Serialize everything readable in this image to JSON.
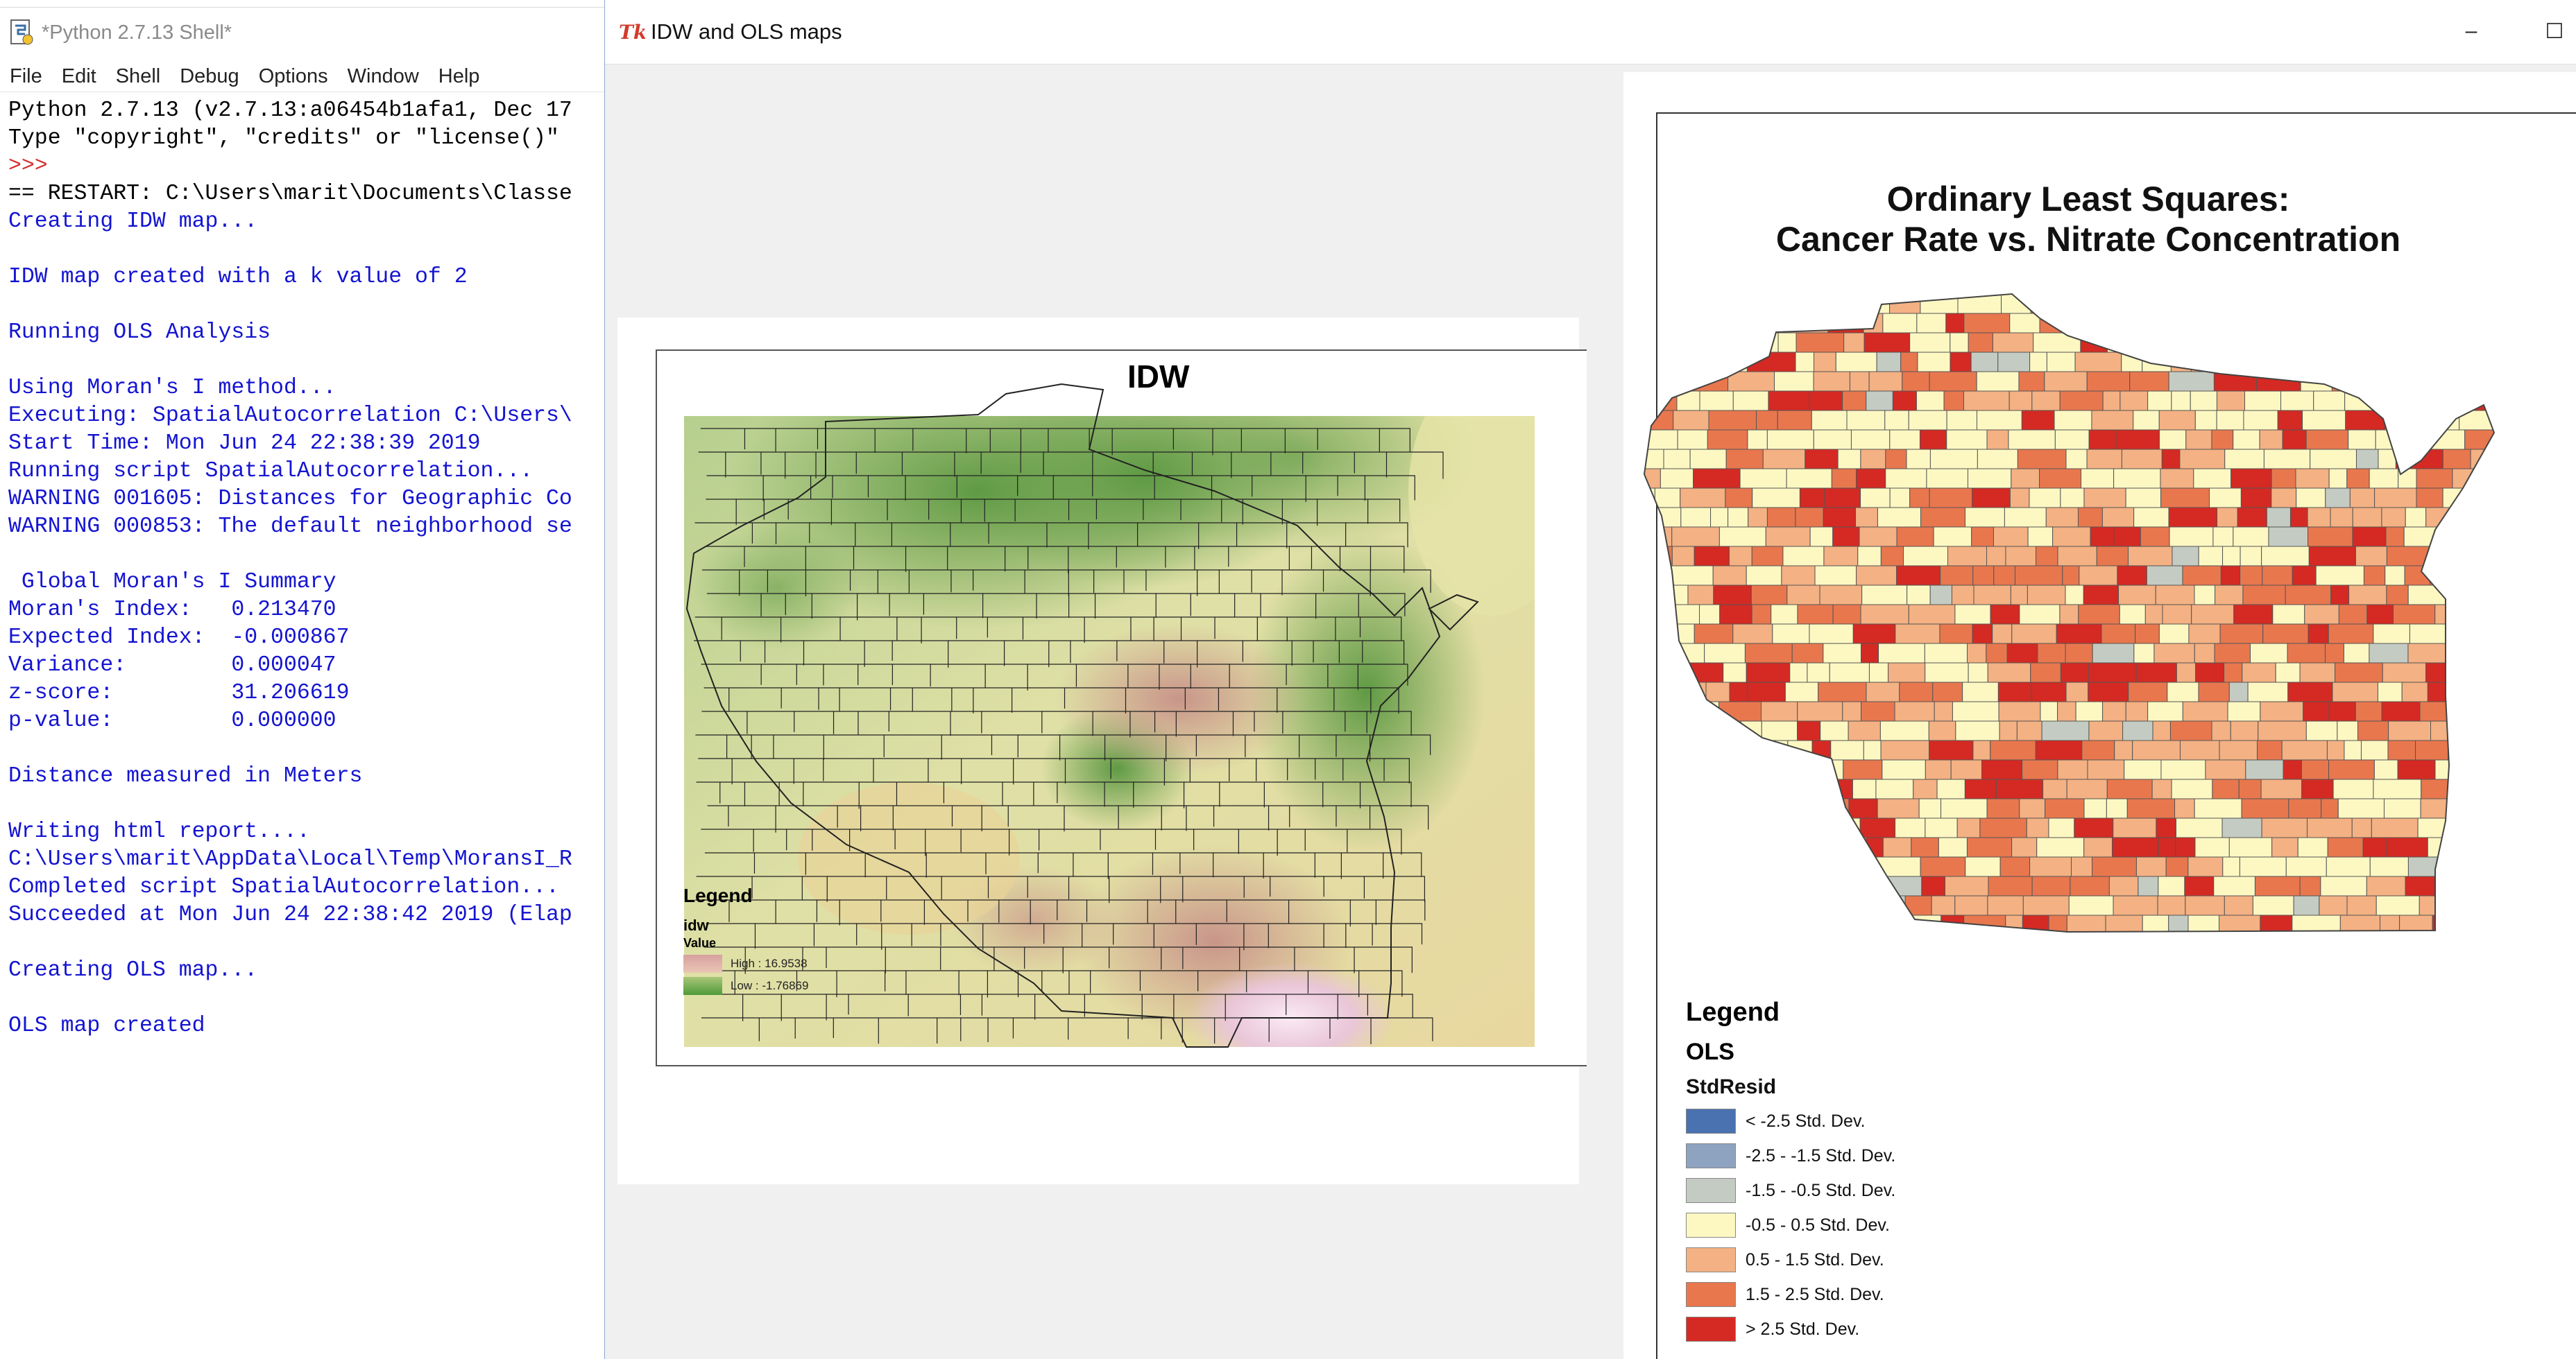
{
  "shell": {
    "title": "*Python 2.7.13 Shell*",
    "menu": [
      "File",
      "Edit",
      "Shell",
      "Debug",
      "Options",
      "Window",
      "Help"
    ],
    "lines": [
      {
        "t": "Python 2.7.13 (v2.7.13:a06454b1afa1, Dec 17",
        "c": "k"
      },
      {
        "t": "Type \"copyright\", \"credits\" or \"license()\"",
        "c": "k"
      },
      {
        "t": ">>>",
        "c": "r"
      },
      {
        "t": "== RESTART: C:\\Users\\marit\\Documents\\Classe",
        "c": "k"
      },
      {
        "t": "Creating IDW map...",
        "c": "b"
      },
      {
        "t": "",
        "c": "b"
      },
      {
        "t": "IDW map created with a k value of 2",
        "c": "b"
      },
      {
        "t": "",
        "c": "b"
      },
      {
        "t": "Running OLS Analysis",
        "c": "b"
      },
      {
        "t": "",
        "c": "b"
      },
      {
        "t": "Using Moran's I method...",
        "c": "b"
      },
      {
        "t": "Executing: SpatialAutocorrelation C:\\Users\\",
        "c": "b"
      },
      {
        "t": "Start Time: Mon Jun 24 22:38:39 2019",
        "c": "b"
      },
      {
        "t": "Running script SpatialAutocorrelation...",
        "c": "b"
      },
      {
        "t": "WARNING 001605: Distances for Geographic Co",
        "c": "b"
      },
      {
        "t": "WARNING 000853: The default neighborhood se",
        "c": "b"
      },
      {
        "t": "",
        "c": "b"
      },
      {
        "t": " Global Moran's I Summary",
        "c": "b"
      },
      {
        "t": "Moran's Index:   0.213470",
        "c": "b"
      },
      {
        "t": "Expected Index:  -0.000867",
        "c": "b"
      },
      {
        "t": "Variance:        0.000047",
        "c": "b"
      },
      {
        "t": "z-score:         31.206619",
        "c": "b"
      },
      {
        "t": "p-value:         0.000000",
        "c": "b"
      },
      {
        "t": "",
        "c": "b"
      },
      {
        "t": "Distance measured in Meters",
        "c": "b"
      },
      {
        "t": "",
        "c": "b"
      },
      {
        "t": "Writing html report....",
        "c": "b"
      },
      {
        "t": "C:\\Users\\marit\\AppData\\Local\\Temp\\MoransI_R",
        "c": "b"
      },
      {
        "t": "Completed script SpatialAutocorrelation...",
        "c": "b"
      },
      {
        "t": "Succeeded at Mon Jun 24 22:38:42 2019 (Elap",
        "c": "b"
      },
      {
        "t": "",
        "c": "b"
      },
      {
        "t": "Creating OLS map...",
        "c": "b"
      },
      {
        "t": "",
        "c": "b"
      },
      {
        "t": "OLS map created",
        "c": "b"
      }
    ],
    "colors": {
      "stdout": "#1414d2",
      "prompt": "#d43030",
      "banner": "#000000"
    }
  },
  "tkwindow": {
    "title": "IDW and OLS maps",
    "minimize_label": "–",
    "maximize_label": "☐"
  },
  "idw_map": {
    "title": "IDW",
    "legend_title": "Legend",
    "layer": "idw",
    "field": "Value",
    "high_label": "High : 16.9538",
    "low_label": "Low : -1.76869",
    "high_color": "#d8a0a0",
    "low_color": "#4f9a3a"
  },
  "ols_map": {
    "title_line1": "Ordinary Least Squares:",
    "title_line2": "Cancer Rate vs. Nitrate Concentration",
    "legend_title": "Legend",
    "layer": "OLS",
    "field": "StdResid",
    "classes": [
      {
        "label": "< -2.5 Std. Dev.",
        "color": "#4a72b0"
      },
      {
        "label": "-2.5 - -1.5 Std. Dev.",
        "color": "#8ea3bf"
      },
      {
        "label": "-1.5 - -0.5 Std. Dev.",
        "color": "#c4cbc3"
      },
      {
        "label": "-0.5 - 0.5 Std. Dev.",
        "color": "#fdf8c2"
      },
      {
        "label": "0.5 - 1.5 Std. Dev.",
        "color": "#f4b183"
      },
      {
        "label": "1.5 - 2.5 Std. Dev.",
        "color": "#e8774e"
      },
      {
        "label": "> 2.5 Std. Dev.",
        "color": "#d42a23"
      }
    ]
  }
}
